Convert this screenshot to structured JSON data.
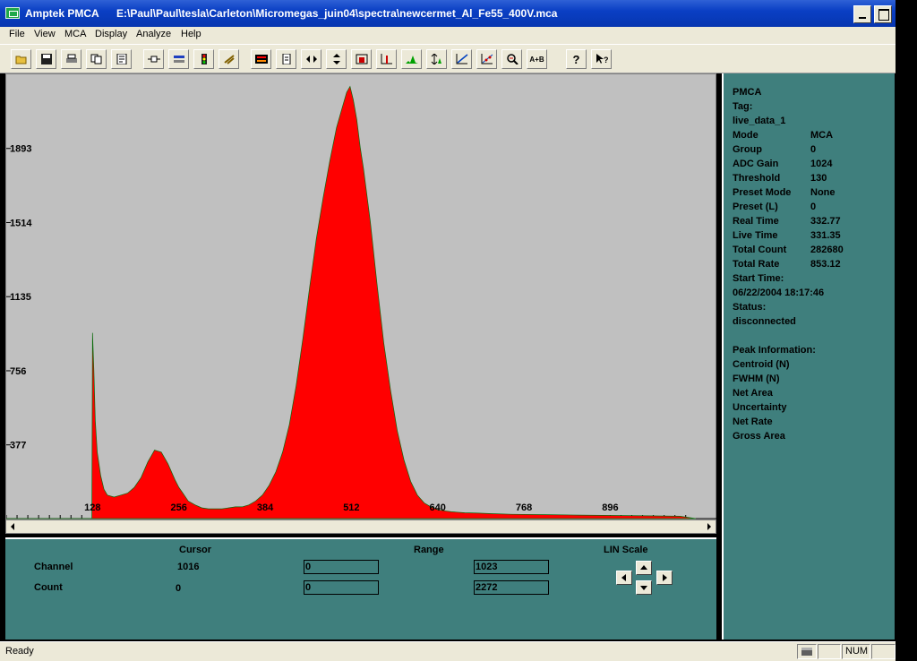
{
  "window": {
    "app_title": "Amptek PMCA",
    "file_path": "E:\\Paul\\Paul\\tesla\\Carleton\\Micromegas_juin04\\spectra\\newcermet_Al_Fe55_400V.mca"
  },
  "menu": [
    "File",
    "View",
    "MCA",
    "Display",
    "Analyze",
    "Help"
  ],
  "toolbar": {
    "buttons": [
      "open-icon",
      "save-icon",
      "print-icon",
      "copy-icon",
      "report-icon",
      "connect-icon",
      "acquire-icon",
      "traffic-light-icon",
      "clear-icon",
      "roi-icon",
      "notes-icon",
      "horizontal-expand-icon",
      "vertical-expand-icon",
      "log-scale-icon",
      "bar-display-icon",
      "peak-icon",
      "auto-scale-icon",
      "linear-fit-icon",
      "calibrate-icon",
      "zoom-icon",
      "a-plus-b-icon",
      "help-icon",
      "context-help-icon"
    ],
    "a_plus_b_label": "A+B",
    "help_label": "?"
  },
  "chart_data": {
    "type": "area",
    "color": "#ff0000",
    "background": "#c0c0c0",
    "xlim": [
      0,
      1023
    ],
    "ylim": [
      0,
      2272
    ],
    "x_ticks": [
      "128",
      "256",
      "384",
      "512",
      "640",
      "768",
      "896"
    ],
    "y_ticks": [
      "377",
      "756",
      "1135",
      "1514",
      "1893"
    ],
    "series": [
      {
        "x": [
          0,
          127,
          128,
          130,
          132,
          135,
          140,
          145,
          150,
          160,
          170,
          180,
          190,
          200,
          210,
          220,
          230,
          240,
          250,
          256,
          262,
          270,
          280,
          290,
          300,
          310,
          320,
          330,
          340,
          350,
          360,
          370,
          380,
          390,
          400,
          410,
          420,
          430,
          440,
          450,
          460,
          470,
          480,
          490,
          500,
          505,
          510,
          515,
          520,
          525,
          530,
          540,
          550,
          560,
          570,
          580,
          590,
          600,
          610,
          620,
          630,
          640,
          650,
          660,
          680,
          700,
          720,
          750,
          800,
          850,
          900,
          950,
          1000,
          1023
        ],
        "y": [
          0,
          0,
          950,
          760,
          500,
          340,
          220,
          150,
          120,
          110,
          120,
          130,
          160,
          210,
          290,
          350,
          340,
          280,
          200,
          160,
          130,
          90,
          70,
          55,
          50,
          50,
          50,
          55,
          60,
          60,
          70,
          90,
          120,
          170,
          240,
          340,
          480,
          680,
          920,
          1180,
          1430,
          1640,
          1830,
          2000,
          2120,
          2180,
          2210,
          2140,
          2040,
          1900,
          1790,
          1520,
          1200,
          900,
          660,
          450,
          300,
          190,
          120,
          80,
          60,
          45,
          40,
          35,
          30,
          28,
          25,
          22,
          20,
          18,
          16,
          14,
          12,
          0
        ]
      }
    ]
  },
  "side_panel": {
    "heading": "PMCA",
    "tag_label": "Tag:",
    "tag_value": "live_data_1",
    "rows": [
      {
        "label": "Mode",
        "value": "MCA"
      },
      {
        "label": "Group",
        "value": "0"
      },
      {
        "label": "ADC Gain",
        "value": "1024"
      },
      {
        "label": "Threshold",
        "value": "130"
      },
      {
        "label": "Preset Mode",
        "value": "None"
      },
      {
        "label": "Preset (L)",
        "value": "0"
      },
      {
        "label": "Real Time",
        "value": "332.77"
      },
      {
        "label": "Live Time",
        "value": "331.35"
      },
      {
        "label": "Total Count",
        "value": "282680"
      },
      {
        "label": "Total Rate",
        "value": "853.12"
      }
    ],
    "start_time_label": "Start Time:",
    "start_time_value": "06/22/2004 18:17:46",
    "status_label": "Status:",
    "status_value": "disconnected",
    "peak_heading": "Peak Information:",
    "peak_rows": [
      "Centroid (N)",
      "FWHM (N)",
      "Net Area",
      "Uncertainty",
      "Net Rate",
      "Gross Area"
    ]
  },
  "bottom_panel": {
    "cursor_label": "Cursor",
    "range_label": "Range",
    "scale_label": "LIN Scale",
    "channel_label": "Channel",
    "count_label": "Count",
    "cursor_channel": "1016",
    "cursor_count": "0",
    "range_channel_min": "0",
    "range_channel_max": "1023",
    "range_count_min": "0",
    "range_count_max": "2272"
  },
  "status_bar": {
    "text": "Ready",
    "num": "NUM"
  }
}
